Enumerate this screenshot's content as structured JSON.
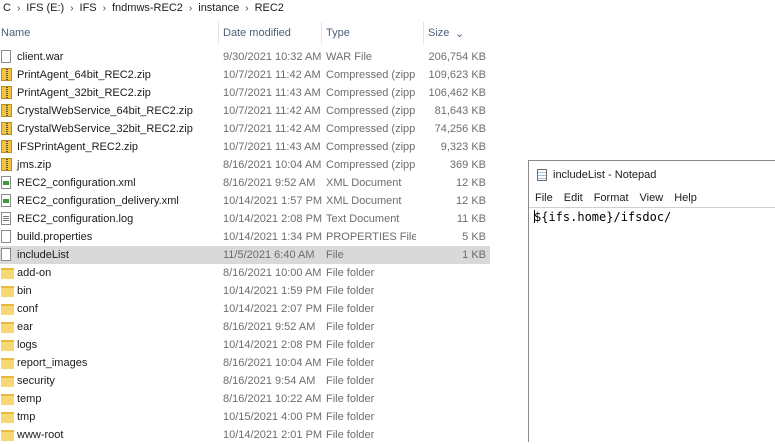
{
  "breadcrumb": [
    "C",
    "IFS (E:)",
    "IFS",
    "fndmws-REC2",
    "instance",
    "REC2"
  ],
  "columns": {
    "name": "Name",
    "date": "Date modified",
    "type": "Type",
    "size": "Size"
  },
  "files": [
    {
      "name": "client.war",
      "date": "9/30/2021 10:32 AM",
      "type": "WAR File",
      "size": "206,754 KB",
      "icon": "file-icon"
    },
    {
      "name": "PrintAgent_64bit_REC2.zip",
      "date": "10/7/2021 11:42 AM",
      "type": "Compressed (zipp...",
      "size": "109,623 KB",
      "icon": "zip-icon"
    },
    {
      "name": "PrintAgent_32bit_REC2.zip",
      "date": "10/7/2021 11:43 AM",
      "type": "Compressed (zipp...",
      "size": "106,462 KB",
      "icon": "zip-icon"
    },
    {
      "name": "CrystalWebService_64bit_REC2.zip",
      "date": "10/7/2021 11:42 AM",
      "type": "Compressed (zipp...",
      "size": "81,643 KB",
      "icon": "zip-icon"
    },
    {
      "name": "CrystalWebService_32bit_REC2.zip",
      "date": "10/7/2021 11:42 AM",
      "type": "Compressed (zipp...",
      "size": "74,256 KB",
      "icon": "zip-icon"
    },
    {
      "name": "IFSPrintAgent_REC2.zip",
      "date": "10/7/2021 11:43 AM",
      "type": "Compressed (zipp...",
      "size": "9,323 KB",
      "icon": "zip-icon"
    },
    {
      "name": "jms.zip",
      "date": "8/16/2021 10:04 AM",
      "type": "Compressed (zipp...",
      "size": "369 KB",
      "icon": "zip-icon"
    },
    {
      "name": "REC2_configuration.xml",
      "date": "8/16/2021 9:52 AM",
      "type": "XML Document",
      "size": "12 KB",
      "icon": "xml-icon"
    },
    {
      "name": "REC2_configuration_delivery.xml",
      "date": "10/14/2021 1:57 PM",
      "type": "XML Document",
      "size": "12 KB",
      "icon": "xml-icon"
    },
    {
      "name": "REC2_configuration.log",
      "date": "10/14/2021 2:08 PM",
      "type": "Text Document",
      "size": "11 KB",
      "icon": "log-icon"
    },
    {
      "name": "build.properties",
      "date": "10/14/2021 1:34 PM",
      "type": "PROPERTIES File",
      "size": "5 KB",
      "icon": "file-icon"
    },
    {
      "name": "includeList",
      "date": "11/5/2021 6:40 AM",
      "type": "File",
      "size": "1 KB",
      "icon": "file-icon",
      "selected": true
    },
    {
      "name": "add-on",
      "date": "8/16/2021 10:00 AM",
      "type": "File folder",
      "size": "",
      "icon": "folder-icon"
    },
    {
      "name": "bin",
      "date": "10/14/2021 1:59 PM",
      "type": "File folder",
      "size": "",
      "icon": "folder-icon"
    },
    {
      "name": "conf",
      "date": "10/14/2021 2:07 PM",
      "type": "File folder",
      "size": "",
      "icon": "folder-icon"
    },
    {
      "name": "ear",
      "date": "8/16/2021 9:52 AM",
      "type": "File folder",
      "size": "",
      "icon": "folder-icon"
    },
    {
      "name": "logs",
      "date": "10/14/2021 2:08 PM",
      "type": "File folder",
      "size": "",
      "icon": "folder-icon"
    },
    {
      "name": "report_images",
      "date": "8/16/2021 10:04 AM",
      "type": "File folder",
      "size": "",
      "icon": "folder-icon"
    },
    {
      "name": "security",
      "date": "8/16/2021 9:54 AM",
      "type": "File folder",
      "size": "",
      "icon": "folder-icon"
    },
    {
      "name": "temp",
      "date": "8/16/2021 10:22 AM",
      "type": "File folder",
      "size": "",
      "icon": "folder-icon"
    },
    {
      "name": "tmp",
      "date": "10/15/2021 4:00 PM",
      "type": "File folder",
      "size": "",
      "icon": "folder-icon"
    },
    {
      "name": "www-root",
      "date": "10/14/2021 2:01 PM",
      "type": "File folder",
      "size": "",
      "icon": "folder-icon"
    }
  ],
  "notepad": {
    "title": "includeList - Notepad",
    "menu": [
      "File",
      "Edit",
      "Format",
      "View",
      "Help"
    ],
    "content": "${ifs.home}/ifsdoc/"
  }
}
